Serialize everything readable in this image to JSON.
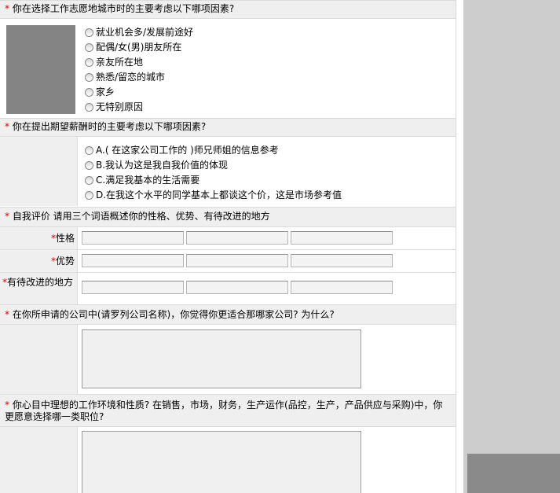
{
  "q1": {
    "required": "*",
    "text": "你在选择工作志愿地城市时的主要考虑以下哪项因素?",
    "options": [
      "就业机会多/发展前途好",
      "配偶/女(男)朋友所在",
      "亲友所在地",
      "熟悉/留恋的城市",
      "家乡",
      "无特别原因"
    ]
  },
  "q2": {
    "required": "*",
    "text": "你在提出期望薪酬时的主要考虑以下哪项因素?",
    "options": [
      "A.( 在这家公司工作的 )师兄师姐的信息参考",
      "B.我认为这是我自我价值的体现",
      "C.满足我基本的生活需要",
      "D.在我这个水平的同学基本上都谈这个价，这是市场参考值"
    ]
  },
  "q3": {
    "required": "*",
    "text": "自我评价 请用三个词语概述你的性格、优势、有待改进的地方",
    "rows": [
      {
        "label": "性格"
      },
      {
        "label": "优势"
      },
      {
        "label": "有待改进的地方"
      }
    ]
  },
  "q4": {
    "required": "*",
    "text": "在你所申请的公司中(请罗列公司名称)，你觉得你更适合那哪家公司? 为什么?"
  },
  "q5": {
    "required": "*",
    "text": "你心目中理想的工作环境和性质? 在销售，市场，财务，生产运作(品控，生产，产品供应与采购)中，你更愿意选择哪一类职位?"
  }
}
